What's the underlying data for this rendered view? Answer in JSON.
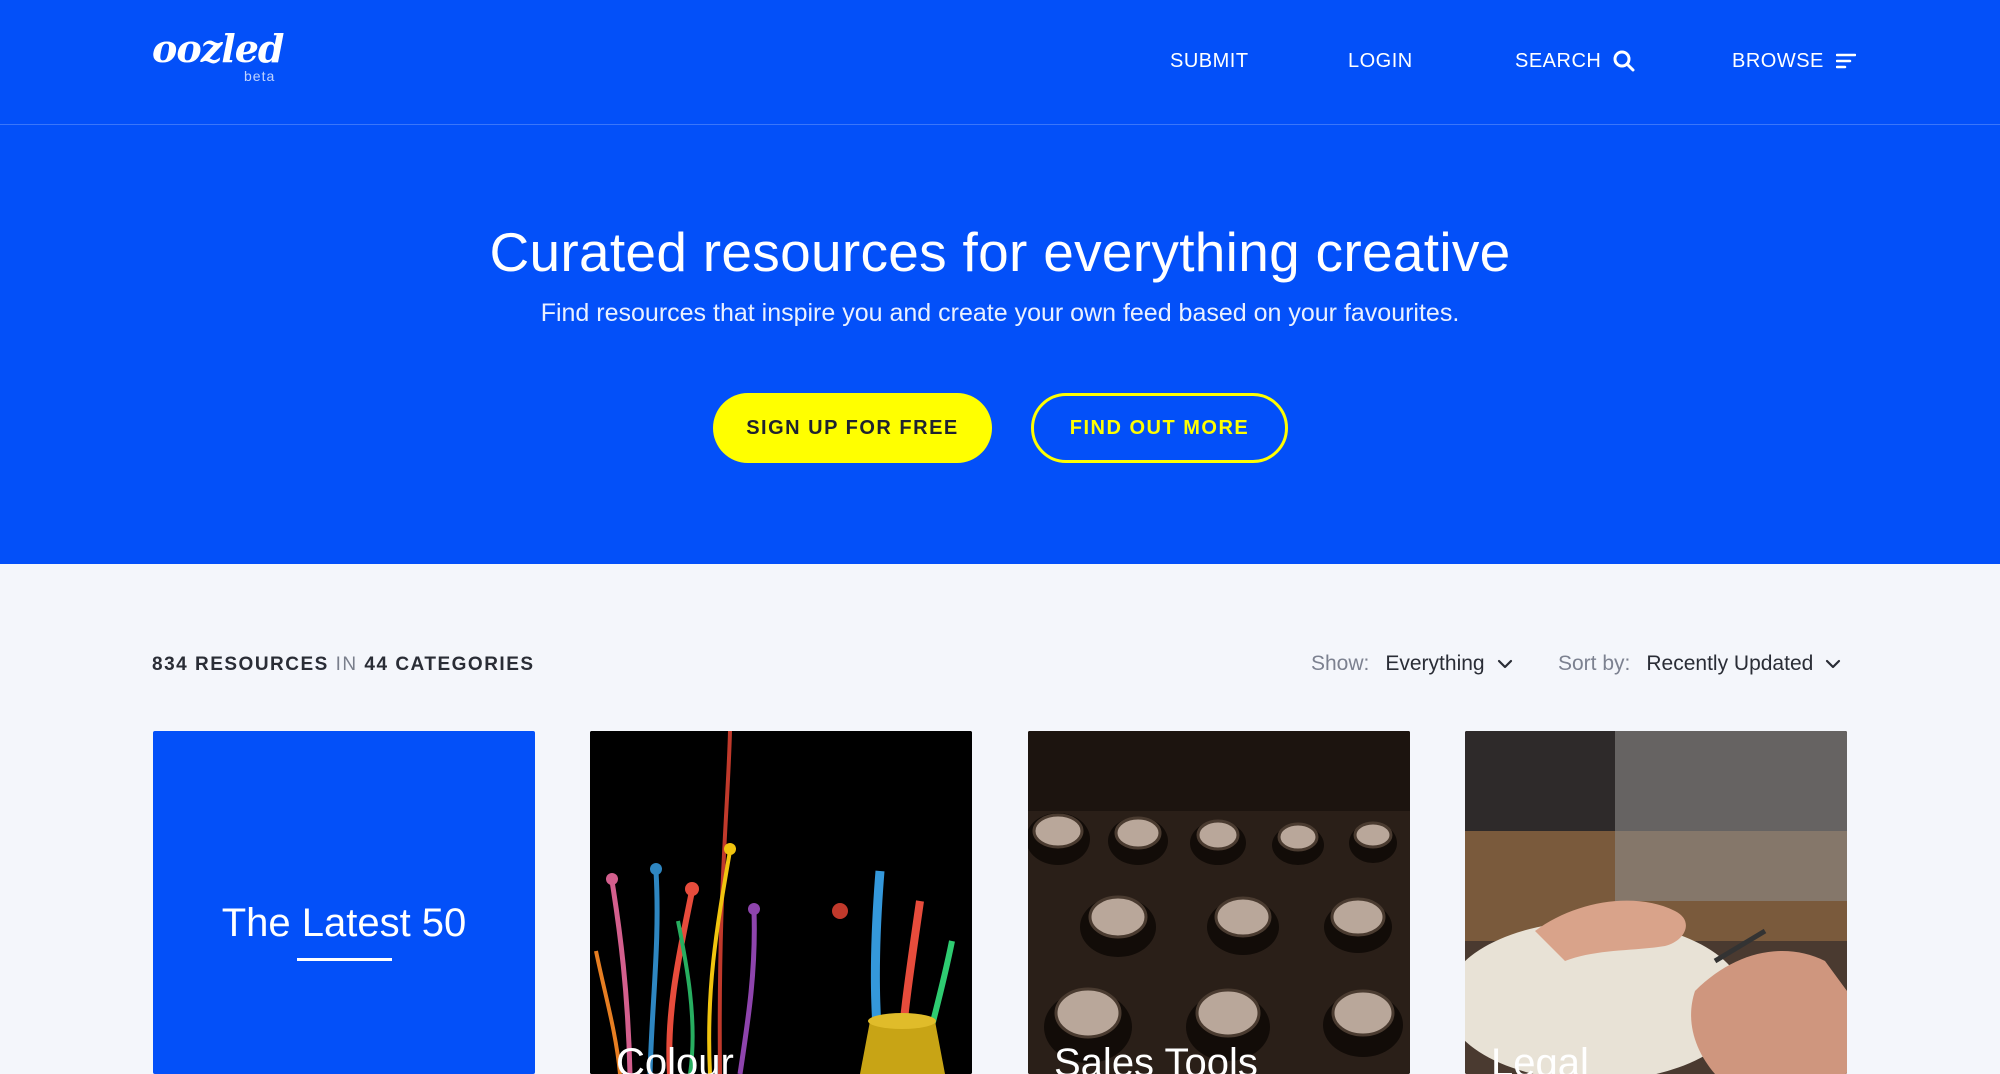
{
  "brand": {
    "logo": "oozled",
    "badge": "beta"
  },
  "nav": {
    "submit": "SUBMIT",
    "login": "LOGIN",
    "search": "SEARCH",
    "browse": "BROWSE"
  },
  "hero": {
    "title": "Curated resources for everything creative",
    "subtitle": "Find resources that inspire you and create your own feed based on your favourites.",
    "primary_button": "SIGN UP FOR FREE",
    "secondary_button": "FIND OUT MORE"
  },
  "toolbar": {
    "resources_count": "834",
    "resources_label": "RESOURCES",
    "in_label": "IN",
    "categories_count": "44",
    "categories_label": "CATEGORIES",
    "show_label": "Show:",
    "show_value": "Everything",
    "sort_label": "Sort by:",
    "sort_value": "Recently Updated"
  },
  "cards": [
    {
      "title": "The Latest 50"
    },
    {
      "title": "Colour"
    },
    {
      "title": "Sales Tools"
    },
    {
      "title": "Legal"
    }
  ],
  "colors": {
    "brand_blue": "#0350f9",
    "accent_yellow": "#ffff00",
    "page_background": "#f4f6fb"
  },
  "icons": {
    "search": "search-icon",
    "browse": "menu-lines-icon",
    "dropdown": "chevron-down-icon"
  }
}
